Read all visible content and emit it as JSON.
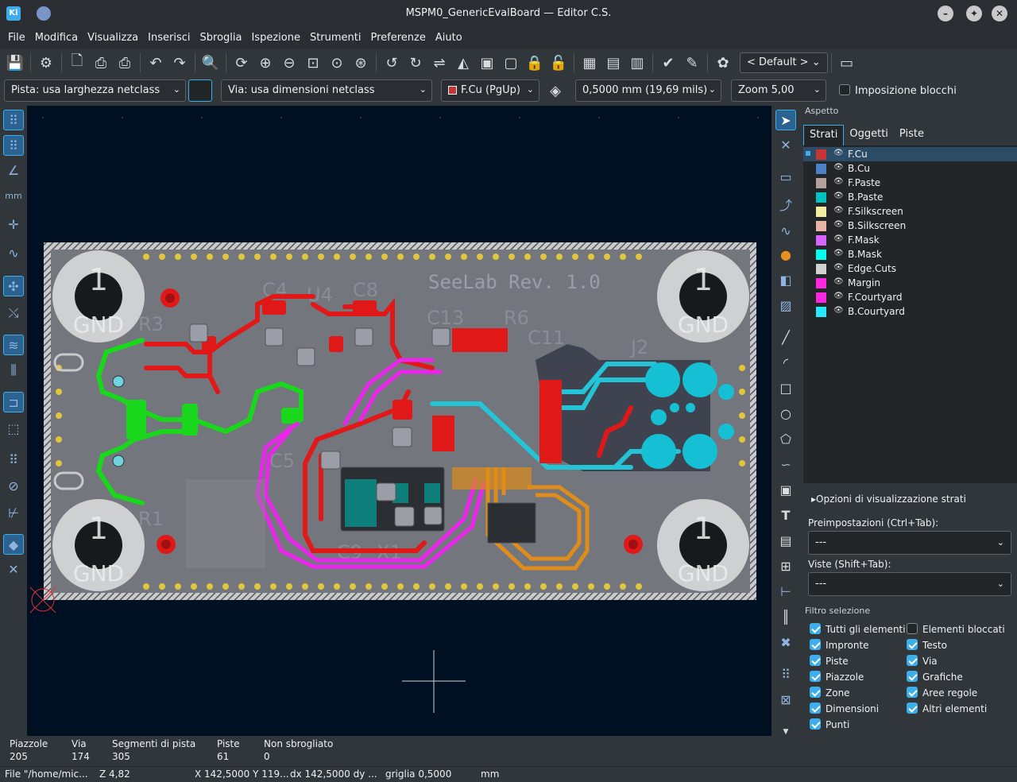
{
  "window": {
    "title": "MSPM0_GenericEvalBoard — Editor C.S.",
    "app_icon_label": "Ki"
  },
  "menu": [
    "File",
    "Modifica",
    "Visualizza",
    "Inserisci",
    "Sbroglia",
    "Ispezione",
    "Strumenti",
    "Preferenze",
    "Aiuto"
  ],
  "toolbar": {
    "viewport_dropdown": "< Default >"
  },
  "toolbar2": {
    "track_width": "Pista: usa larghezza netclass",
    "via_size": "Via: usa dimensioni netclass",
    "layer": "F.Cu (PgUp)",
    "grid": "0,5000 mm (19,69 mils)",
    "zoom": "Zoom 5,00",
    "constrain_label": "Imposizione blocchi"
  },
  "board": {
    "title_text": "SeeLab Rev. 1.0",
    "mount_hole_number": "1",
    "mount_hole_net": "GND",
    "refdes": [
      "C4",
      "U4",
      "C8",
      "C13",
      "R6",
      "C11",
      "J2",
      "C5",
      "R3",
      "R1",
      "C9",
      "X1"
    ]
  },
  "panel": {
    "header": "Aspetto",
    "tabs": [
      "Strati",
      "Oggetti",
      "Piste"
    ],
    "layers": [
      {
        "name": "F.Cu",
        "color": "#c83434"
      },
      {
        "name": "B.Cu",
        "color": "#4d7fc4"
      },
      {
        "name": "F.Paste",
        "color": "#b4a09a"
      },
      {
        "name": "B.Paste",
        "color": "#00c2c2"
      },
      {
        "name": "F.Silkscreen",
        "color": "#f2eda1"
      },
      {
        "name": "B.Silkscreen",
        "color": "#e8b2a7"
      },
      {
        "name": "F.Mask",
        "color": "#d864ff"
      },
      {
        "name": "B.Mask",
        "color": "#02ffee"
      },
      {
        "name": "Edge.Cuts",
        "color": "#d0d2cd"
      },
      {
        "name": "Margin",
        "color": "#ff26e2"
      },
      {
        "name": "F.Courtyard",
        "color": "#ff26e2"
      },
      {
        "name": "B.Courtyard",
        "color": "#26e9ff"
      }
    ],
    "layer_options": "Opzioni di visualizzazione strati",
    "presets_label": "Preimpostazioni (Ctrl+Tab):",
    "presets_value": "---",
    "views_label": "Viste (Shift+Tab):",
    "views_value": "---",
    "filter_title": "Filtro selezione",
    "filters": [
      {
        "label": "Tutti gli elementi",
        "checked": true
      },
      {
        "label": "Elementi bloccati",
        "checked": false
      },
      {
        "label": "Impronte",
        "checked": true
      },
      {
        "label": "Testo",
        "checked": true
      },
      {
        "label": "Piste",
        "checked": true
      },
      {
        "label": "Via",
        "checked": true
      },
      {
        "label": "Piazzole",
        "checked": true
      },
      {
        "label": "Grafiche",
        "checked": true
      },
      {
        "label": "Zone",
        "checked": true
      },
      {
        "label": "Aree regole",
        "checked": true
      },
      {
        "label": "Dimensioni",
        "checked": true
      },
      {
        "label": "Altri elementi",
        "checked": true
      },
      {
        "label": "Punti",
        "checked": true
      }
    ]
  },
  "messages": {
    "headers": [
      "Piazzole",
      "Via",
      "Segmenti di pista",
      "Piste",
      "Non sbrogliato"
    ],
    "values": [
      "205",
      "174",
      "305",
      "61",
      "0"
    ]
  },
  "status": {
    "file": "File \"/home/mic...",
    "zoom": "Z 4,82",
    "coords": "X 142,5000  Y 119...",
    "delta": "dx 142,5000  dy ...",
    "grid": "griglia 0,5000",
    "units": "mm"
  }
}
